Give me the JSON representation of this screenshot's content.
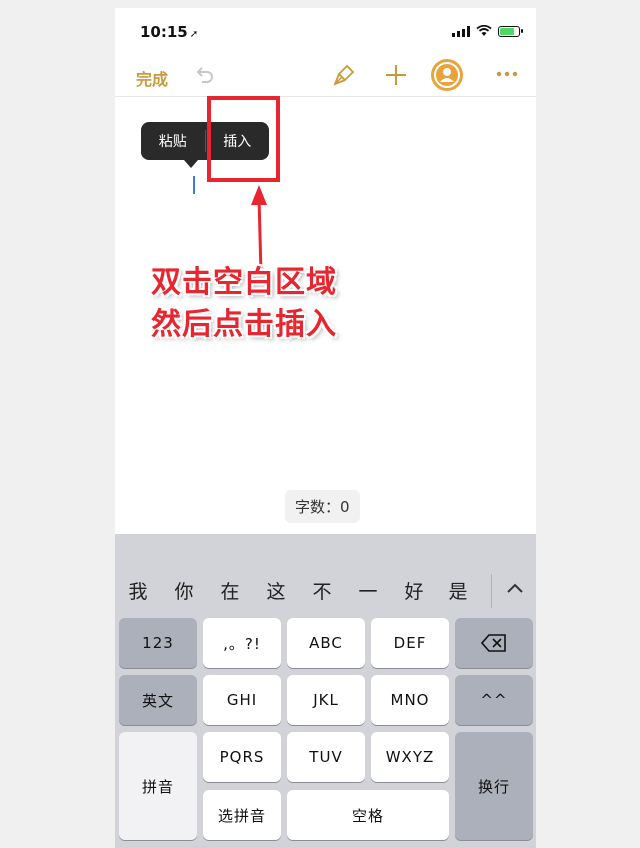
{
  "status_bar": {
    "time": "10:15",
    "location_arrow": "➚"
  },
  "toolbar": {
    "done_label": "完成",
    "icons": [
      "undo-icon",
      "brush-icon",
      "plus-icon",
      "collaborate-icon",
      "more-icon"
    ],
    "accent_color": "#c89a3a"
  },
  "context_menu": {
    "items": [
      "粘贴",
      "插入"
    ]
  },
  "annotation": {
    "line1": "双击空白区域",
    "line2": "然后点击插入",
    "color": "#e8262f"
  },
  "word_count": "字数：0",
  "keyboard": {
    "candidates": [
      "我",
      "你",
      "在",
      "这",
      "不",
      "一",
      "好",
      "是"
    ],
    "rows": {
      "r1": [
        "123",
        ",。?!",
        "ABC",
        "DEF",
        "⌫"
      ],
      "r2": [
        "英文",
        "GHI",
        "JKL",
        "MNO",
        "^^"
      ],
      "r3": [
        "拼音",
        "PQRS",
        "TUV",
        "WXYZ",
        "换行"
      ],
      "r4": [
        "选拼音",
        "空格"
      ]
    }
  }
}
